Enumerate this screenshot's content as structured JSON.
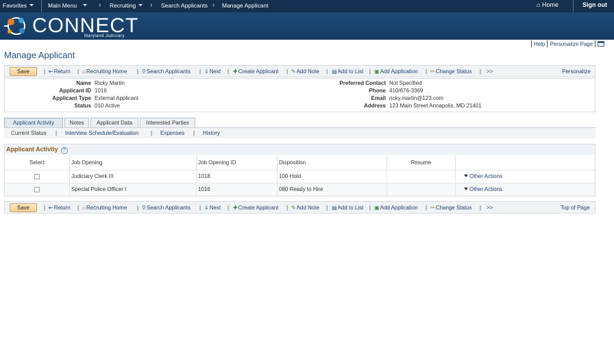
{
  "topnav": {
    "favorites": "Favorites",
    "main_menu": "Main Menu",
    "recruiting": "Recruiting",
    "search_applicants": "Search Applicants",
    "manage_applicant": "Manage Applicant",
    "home": "Home",
    "sign_out": "Sign out"
  },
  "banner": {
    "logo_text": "CONNECT",
    "logo_sub": "Maryland Judiciary"
  },
  "utility": {
    "help": "Help",
    "personalize_page": "Personalize Page"
  },
  "page": {
    "title": "Manage Applicant"
  },
  "toolbar": {
    "save": "Save",
    "return": "Return",
    "recruiting_home": "Recruiting Home",
    "search_applicants": "Search Applicants",
    "next": "Next",
    "create_applicant": "Create Applicant",
    "add_note": "Add Note",
    "add_to_list": "Add to List",
    "add_application": "Add Application",
    "change_status": "Change Status",
    "more": ">>",
    "personalize": "Personalize",
    "top_of_page": "Top of Page"
  },
  "applicant": {
    "name_label": "Name",
    "name": "Ricky Martin",
    "id_label": "Applicant ID",
    "id": "1016",
    "type_label": "Applicant Type",
    "type": "External Applicant",
    "status_label": "Status",
    "status": "010 Active",
    "pref_label": "Preferred Contact",
    "pref": "Not Specified",
    "phone_label": "Phone",
    "phone": "410/676-3369",
    "email_label": "Email",
    "email": "ricky.martin@123.com",
    "address_label": "Address",
    "address": "123 Main Street Annapolis, MD 21401"
  },
  "tabs": [
    {
      "label": "Applicant Activity"
    },
    {
      "label": "Notes"
    },
    {
      "label": "Applicant Data"
    },
    {
      "label": "Interested Parties"
    }
  ],
  "subnav": {
    "current_status": "Current Status",
    "interview": "Interview Schedule/Evaluation",
    "expenses": "Expenses",
    "history": "History"
  },
  "grid": {
    "title": "Applicant Activity",
    "columns": {
      "select": "Select",
      "job_opening": "Job Opening",
      "job_opening_id": "Job Opening ID",
      "disposition": "Disposition",
      "resume": "Resume"
    },
    "rows": [
      {
        "job_opening": "Judiciary Clerk III",
        "job_opening_id": "1018",
        "disposition": "100 Hold",
        "other_actions": "Other Actions"
      },
      {
        "job_opening": "Special Police Officer I",
        "job_opening_id": "1016",
        "disposition": "080 Ready to Hire",
        "other_actions": "Other Actions"
      }
    ]
  },
  "icons": {
    "return": "return-icon",
    "recruiting_home": "house-icon",
    "search": "search-icon",
    "next": "next-icon",
    "create": "create-applicant-icon",
    "note": "note-icon",
    "list": "list-icon",
    "application": "application-icon",
    "status": "change-status-icon"
  },
  "colors": {
    "nav": "#14304e",
    "banner": "#1d4977",
    "link": "#1f3f6e",
    "title": "#1f4e79",
    "save_btn": "#f7cf8f"
  }
}
